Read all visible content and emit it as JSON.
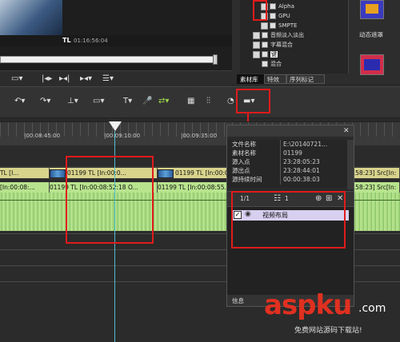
{
  "preview": {
    "tl_label": "TL",
    "timecode": "01:16:56:04"
  },
  "effects_tree": {
    "items": [
      {
        "label": "Alpha",
        "indent": 2
      },
      {
        "label": "GPU",
        "indent": 2
      },
      {
        "label": "SMPTE",
        "indent": 2
      },
      {
        "label": "音频淡入淡出",
        "indent": 1
      },
      {
        "label": "字幕混合",
        "indent": 1
      },
      {
        "label": "键",
        "indent": 1
      },
      {
        "label": "混合",
        "indent": 1
      }
    ]
  },
  "effect_preview": {
    "label": "动态遮罩"
  },
  "tabs": [
    {
      "label": "素材库",
      "active": true
    },
    {
      "label": "特效",
      "active": false
    },
    {
      "label": "序列标记",
      "active": false
    }
  ],
  "timeline": {
    "ruler_labels": [
      "|00:08:45:00",
      "|00:09:10:00",
      "|00:09:35:00"
    ],
    "clips_row1": [
      {
        "text": "TL [I..."
      },
      {
        "text": "01199  TL [In:00:0..."
      },
      {
        "text": "01199  TL [In:00:08:55..."
      },
      {
        "text": "...58:23]  Src[In:"
      }
    ],
    "clips_row2": [
      {
        "text": "[In:00:08:..."
      },
      {
        "text": "01199  TL [In:00:08:52:18 O..."
      },
      {
        "text": "01199  TL [In:00:08:55..."
      },
      {
        "text": "...58:23]  Src[In:"
      }
    ]
  },
  "info_panel": {
    "rows": [
      {
        "key": "文件名称",
        "value": "E:\\20140721..."
      },
      {
        "key": "素材名称",
        "value": "01199"
      },
      {
        "key": "源入点",
        "value": "23:28:05:23"
      },
      {
        "key": "源出点",
        "value": "23:28:44:01"
      },
      {
        "key": "源持续时间",
        "value": "00:00:38:03"
      }
    ],
    "page": "1/1",
    "layer_count": "1",
    "layout_item": "视频布局",
    "footer_tab": "信息"
  },
  "watermark": {
    "main": "aspku",
    "tld": ".com",
    "sub": "免费网站源码下载站!"
  },
  "colors": {
    "highlight_red": "#e01b1b",
    "clip_yellow": "#d8d48c",
    "audio_green": "#b8e48e",
    "playhead": "#4fc0d0"
  }
}
